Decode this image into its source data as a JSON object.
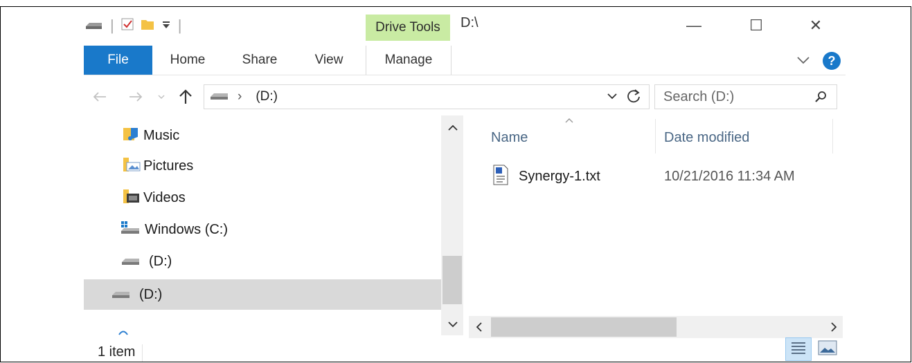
{
  "window": {
    "title": "D:\\",
    "context_tab": "Drive Tools",
    "minimize": "—",
    "maximize": "☐",
    "close": "✕"
  },
  "ribbon": {
    "tabs": [
      {
        "label": "File"
      },
      {
        "label": "Home"
      },
      {
        "label": "Share"
      },
      {
        "label": "View"
      },
      {
        "label": "Manage"
      }
    ],
    "help": "?"
  },
  "address_bar": {
    "path": "(D:)",
    "search_placeholder": "Search  (D:)"
  },
  "navigation_pane": {
    "items": [
      {
        "label": "Music"
      },
      {
        "label": "Pictures"
      },
      {
        "label": "Videos"
      },
      {
        "label": "Windows (C:)"
      },
      {
        "label": "(D:)"
      },
      {
        "label": "(D:)"
      }
    ]
  },
  "file_list": {
    "columns": [
      {
        "label": "Name"
      },
      {
        "label": "Date modified"
      }
    ],
    "rows": [
      {
        "name": "Synergy-1.txt",
        "date_modified": "10/21/2016 11:34 AM"
      }
    ]
  },
  "status_bar": {
    "item_count": "1 item"
  },
  "colors": {
    "file_tab": "#1979ca",
    "drive_tools": "#c9eba3",
    "selected_nav": "#d9d9d9",
    "header_text": "#4a6785"
  }
}
